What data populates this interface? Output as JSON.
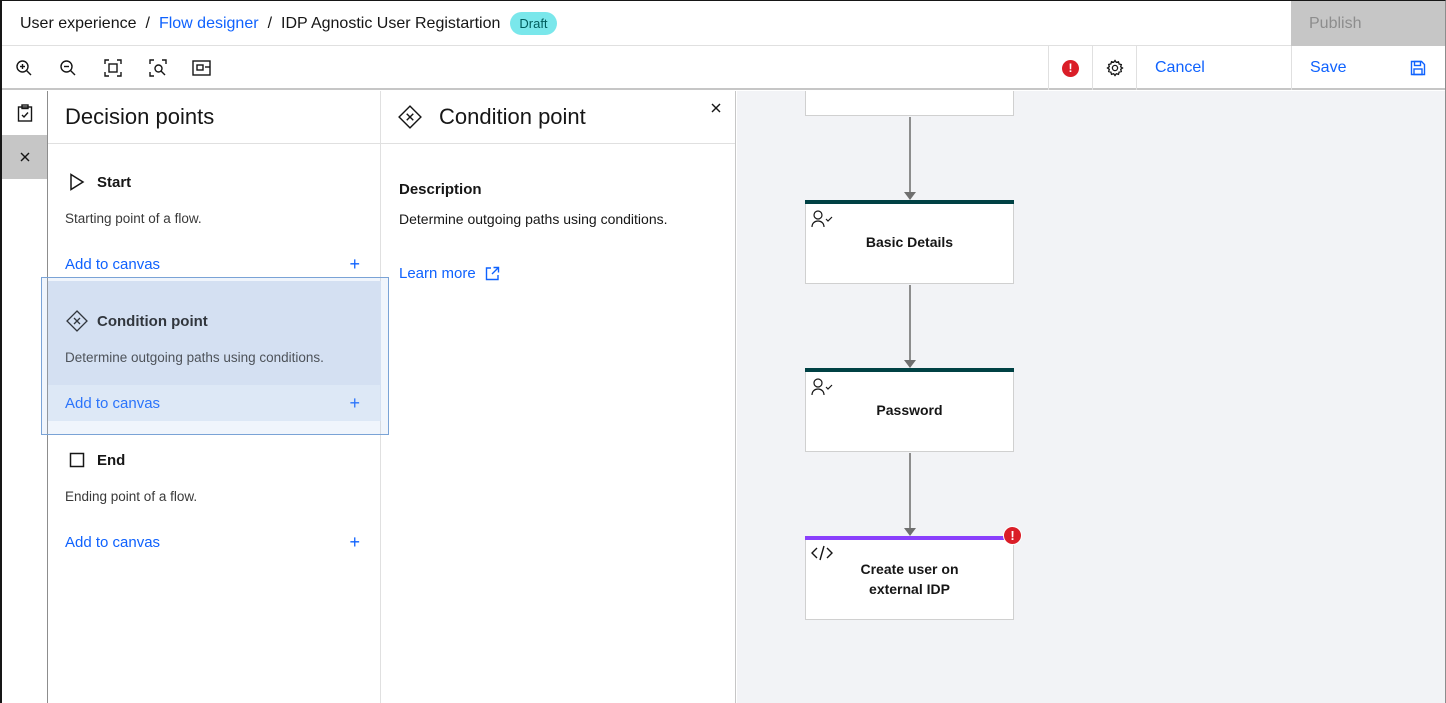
{
  "header": {
    "breadcrumb": [
      {
        "label": "User experience",
        "link": false
      },
      {
        "label": "Flow designer",
        "link": true
      },
      {
        "label": "IDP Agnostic User Registartion",
        "link": false
      }
    ],
    "separator": "/",
    "status_badge": "Draft",
    "publish_label": "Publish"
  },
  "toolbar": {
    "icons": [
      "zoom-in-icon",
      "zoom-out-icon",
      "fit-to-screen-icon",
      "zoom-area-icon",
      "minimap-icon"
    ],
    "error_indicator": "!",
    "cancel_label": "Cancel",
    "save_label": "Save"
  },
  "rail": {
    "items": [
      "clipboard-icon",
      "close-icon"
    ]
  },
  "decision_panel": {
    "title": "Decision points",
    "items": [
      {
        "name": "Start",
        "description": "Starting point of a flow.",
        "add_label": "Add to canvas",
        "icon": "play-outline-icon"
      },
      {
        "name": "Condition point",
        "description": "Determine outgoing paths using conditions.",
        "add_label": "Add to canvas",
        "icon": "condition-diamond-icon",
        "selected": true
      },
      {
        "name": "End",
        "description": "Ending point of a flow.",
        "add_label": "Add to canvas",
        "icon": "square-outline-icon"
      }
    ],
    "add_symbol": "+"
  },
  "detail_panel": {
    "title": "Condition point",
    "description_label": "Description",
    "description": "Determine outgoing paths using conditions.",
    "learn_more": "Learn more"
  },
  "canvas": {
    "nodes": [
      {
        "label": "",
        "accent": "#004144",
        "icon": "user-check-icon"
      },
      {
        "label": "Basic Details",
        "accent": "#004144",
        "icon": "user-check-icon"
      },
      {
        "label": "Password",
        "accent": "#004144",
        "icon": "user-check-icon"
      },
      {
        "label": "Create user on external IDP",
        "accent": "#8a3ffc",
        "icon": "code-icon",
        "error": "!"
      }
    ]
  },
  "colors": {
    "link": "#0f62fe",
    "draft_badge": "#7ae7eb",
    "error": "#da1e28",
    "selected_bg": "#dde6f3"
  }
}
